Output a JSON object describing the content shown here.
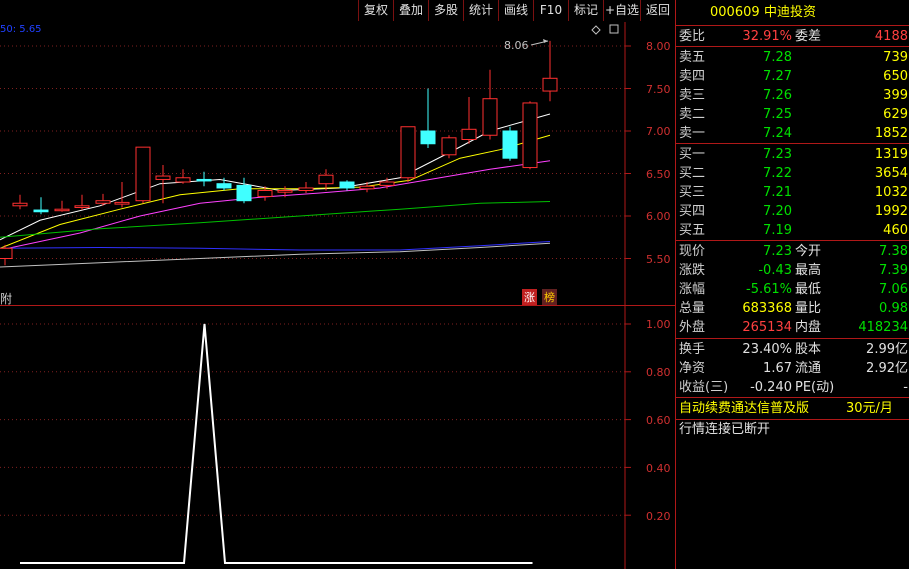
{
  "toolbar": {
    "buttons": [
      "复权",
      "叠加",
      "多股",
      "统计",
      "画线",
      "F10",
      "标记",
      "+自选",
      "返回"
    ]
  },
  "price_chart": {
    "ma_label": "50: 5.65",
    "high_marker": "8.06",
    "y_ticks": [
      "8.00",
      "7.50",
      "7.00",
      "6.50",
      "6.00",
      "5.50"
    ],
    "left_mark": "附",
    "badge_zhang": "涨",
    "badge_bang": "榜"
  },
  "indicator": {
    "y_ticks": [
      "1.00",
      "0.80",
      "0.60",
      "0.40",
      "0.20"
    ]
  },
  "chart_data": {
    "type": "line",
    "y_ticks": [
      1.0,
      0.8,
      0.6,
      0.4,
      0.2
    ],
    "ylim": [
      0,
      1.0
    ],
    "values": [
      0,
      0,
      0,
      0,
      0,
      0,
      0,
      0,
      0,
      1,
      0,
      0,
      0,
      0,
      0,
      0,
      0,
      0,
      0,
      0,
      0,
      0,
      0,
      0,
      0,
      0
    ]
  },
  "colors": {
    "accent": "#ff4040",
    "up": "#ff4040",
    "down": "#00e000",
    "frame": "#b01818"
  },
  "panel": {
    "code": "000609",
    "name": "中迪投资",
    "weibi_label": "委比",
    "weibi_value": "32.91%",
    "weicha_label": "委差",
    "weicha_value": "4188",
    "sells": [
      {
        "label": "卖五",
        "price": "7.28",
        "vol": "739"
      },
      {
        "label": "卖四",
        "price": "7.27",
        "vol": "650"
      },
      {
        "label": "卖三",
        "price": "7.26",
        "vol": "399"
      },
      {
        "label": "卖二",
        "price": "7.25",
        "vol": "629"
      },
      {
        "label": "卖一",
        "price": "7.24",
        "vol": "1852"
      }
    ],
    "buys": [
      {
        "label": "买一",
        "price": "7.23",
        "vol": "1319"
      },
      {
        "label": "买二",
        "price": "7.22",
        "vol": "3654"
      },
      {
        "label": "买三",
        "price": "7.21",
        "vol": "1032"
      },
      {
        "label": "买四",
        "price": "7.20",
        "vol": "1992"
      },
      {
        "label": "买五",
        "price": "7.19",
        "vol": "460"
      }
    ],
    "quote": [
      {
        "l1": "现价",
        "v1": "7.23",
        "c1": "green",
        "l2": "今开",
        "v2": "7.38",
        "c2": "green"
      },
      {
        "l1": "涨跌",
        "v1": "-0.43",
        "c1": "green",
        "l2": "最高",
        "v2": "7.39",
        "c2": "green"
      },
      {
        "l1": "涨幅",
        "v1": "-5.61%",
        "c1": "green",
        "l2": "最低",
        "v2": "7.06",
        "c2": "green"
      },
      {
        "l1": "总量",
        "v1": "683368",
        "c1": "yellow",
        "l2": "量比",
        "v2": "0.98",
        "c2": "green"
      },
      {
        "l1": "外盘",
        "v1": "265134",
        "c1": "red",
        "l2": "内盘",
        "v2": "418234",
        "c2": "green"
      }
    ],
    "fin": [
      {
        "l1": "换手",
        "v1": "23.40%",
        "l2": "股本",
        "v2": "2.99亿"
      },
      {
        "l1": "净资",
        "v1": "1.67",
        "l2": "流通",
        "v2": "2.92亿"
      },
      {
        "l1": "收益(三)",
        "v1": "-0.240",
        "l2": "PE(动)",
        "v2": "-"
      }
    ],
    "promo_text": "自动续费通达信普及版",
    "promo_price": "30元/月",
    "status": "行情连接已断开"
  }
}
